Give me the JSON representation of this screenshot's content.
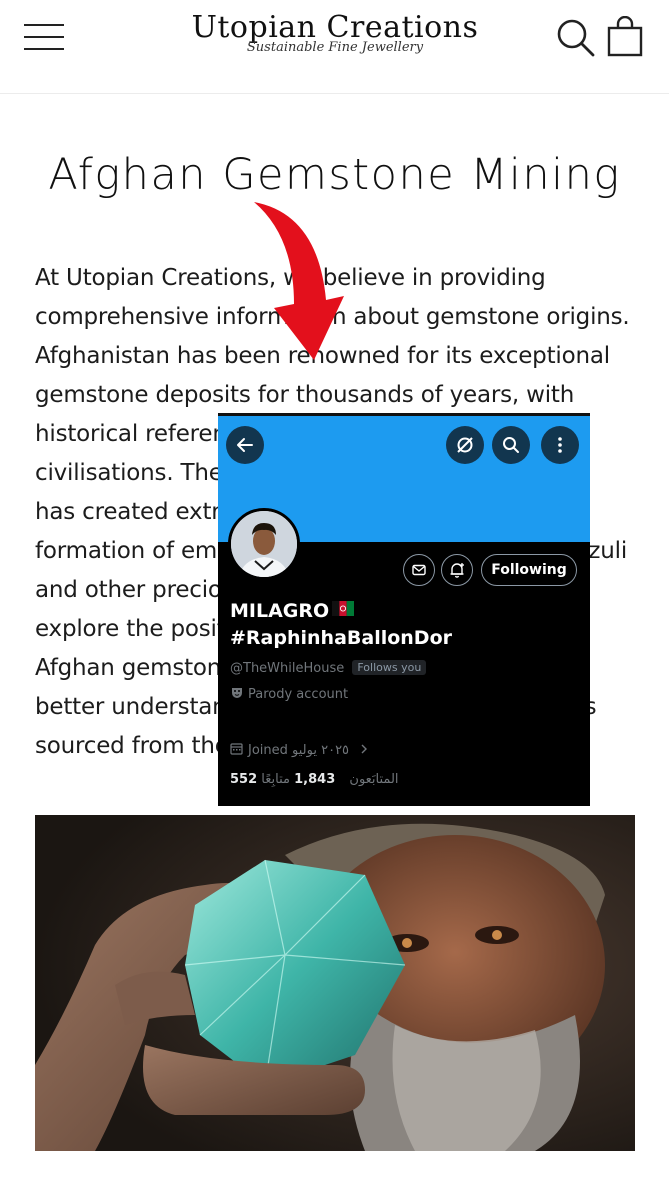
{
  "header": {
    "logo_name": "Utopian Creations",
    "logo_tagline": "Sustainable Fine Jewellery",
    "menu_icon": "hamburger-menu-icon",
    "search_icon": "search-icon",
    "bag_icon": "shopping-bag-icon"
  },
  "article": {
    "title": "Afghan Gemstone Mining",
    "paragraph": "At Utopian Creations, we believe in providing comprehensive information about gemstone origins. Afghanistan has been renowned for its exceptional gemstone deposits for thousands of years, with historical references dating back to ancient civilisations. The country's geological complexity has created extraordinary conditions for the formation of emeralds, rubies, sapphires, lapis lazuli and other precious stones. This guide aims to explore the positive and challenging aspects of Afghan gemstone mining to help our customers better understand the complexities of gemstones sourced from the region."
  },
  "profile_card": {
    "display_name": "MILAGRO",
    "display_hashtag": "#RaphinhaBallonDor",
    "handle": "@TheWhileHouse",
    "follows_you": "Follows you",
    "parody_label": "Parody account",
    "joined": "Joined ٢٠٢٥ يوليو",
    "followers_count": "552",
    "followers_label": "المتابَعون",
    "following_count": "1,843",
    "following_label": "متابِعًا",
    "following_button": "Following",
    "colors": {
      "banner": "#1d9bf0",
      "background": "#000000",
      "text": "#e7e9ea",
      "muted": "#71767b"
    }
  },
  "annotation": {
    "arrow_color": "#e3101c"
  }
}
